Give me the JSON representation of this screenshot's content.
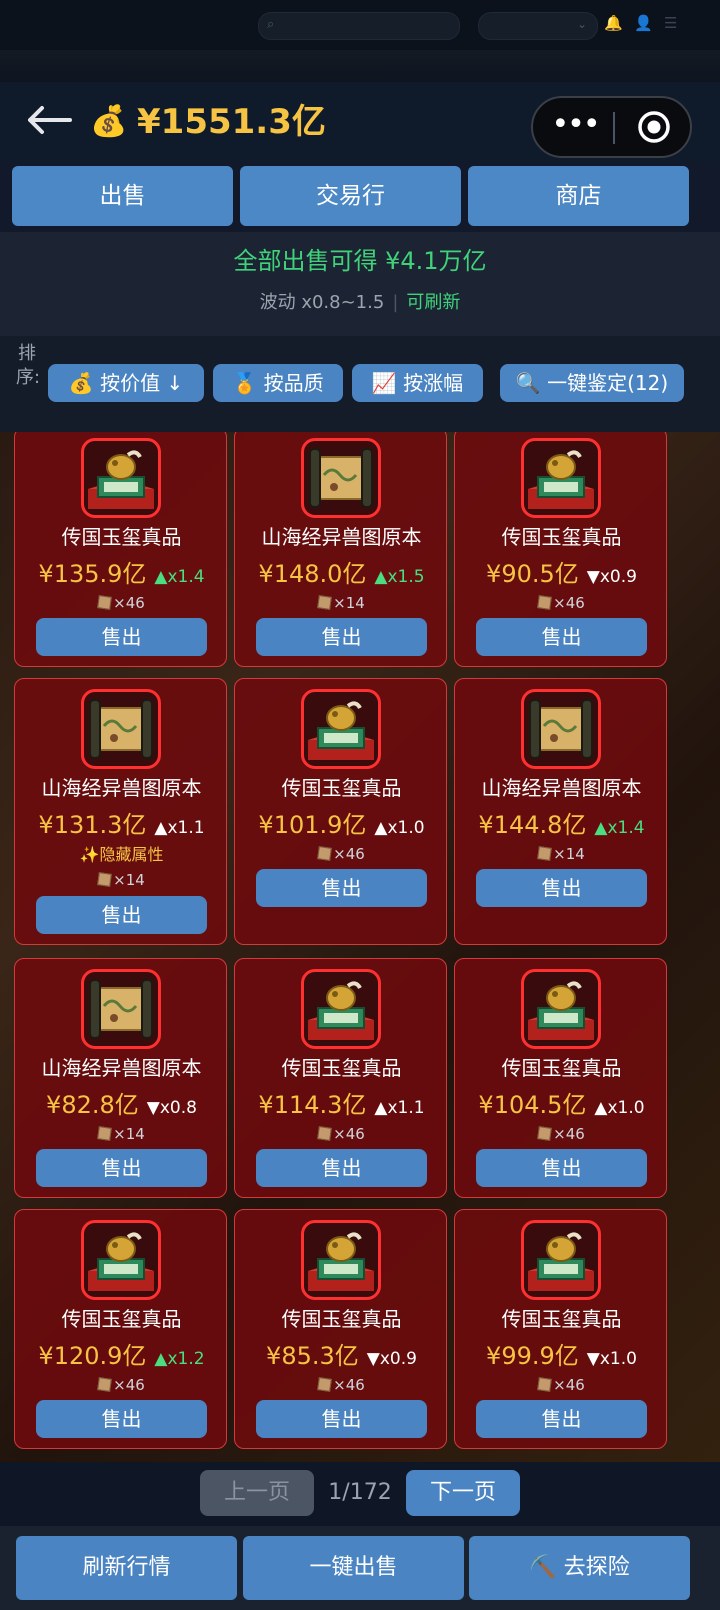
{
  "header": {
    "balance": "¥1551.3亿",
    "bag_icon": "💰"
  },
  "tabs": [
    {
      "label": "出售"
    },
    {
      "label": "交易行"
    },
    {
      "label": "商店"
    }
  ],
  "summary": {
    "total_prefix": "全部出售可得 ",
    "total_value": "¥4.1万亿",
    "fluctuation": "波动 x0.8~1.5",
    "refreshable": "可刷新"
  },
  "sort": {
    "label": "排序:",
    "buttons": [
      {
        "label": "💰 按价值 ↓"
      },
      {
        "label": "🏅 按品质"
      },
      {
        "label": "📈 按涨幅"
      },
      {
        "label": "🔍 一键鉴定(12)"
      }
    ]
  },
  "items": [
    {
      "name": "传国玉玺真品",
      "price": "¥135.9亿",
      "trend": "▲x1.4",
      "trend_color": "#4ade80",
      "qty": "×46",
      "icon": "jade-seal-icon",
      "sell": "售出"
    },
    {
      "name": "山海经异兽图原本",
      "price": "¥148.0亿",
      "trend": "▲x1.5",
      "trend_color": "#4ade80",
      "qty": "×14",
      "icon": "scroll-icon",
      "sell": "售出"
    },
    {
      "name": "传国玉玺真品",
      "price": "¥90.5亿",
      "trend": "▼x0.9",
      "trend_color": "#ffffff",
      "qty": "×46",
      "icon": "jade-seal-icon",
      "sell": "售出"
    },
    {
      "name": "山海经异兽图原本",
      "price": "¥131.3亿",
      "trend": "▲x1.1",
      "trend_color": "#ffffff",
      "hidden": "✨隐藏属性",
      "qty": "×14",
      "icon": "scroll-icon",
      "sell": "售出"
    },
    {
      "name": "传国玉玺真品",
      "price": "¥101.9亿",
      "trend": "▲x1.0",
      "trend_color": "#ffffff",
      "qty": "×46",
      "icon": "jade-seal-icon",
      "sell": "售出"
    },
    {
      "name": "山海经异兽图原本",
      "price": "¥144.8亿",
      "trend": "▲x1.4",
      "trend_color": "#4ade80",
      "qty": "×14",
      "icon": "scroll-icon",
      "sell": "售出"
    },
    {
      "name": "山海经异兽图原本",
      "price": "¥82.8亿",
      "trend": "▼x0.8",
      "trend_color": "#ffffff",
      "qty": "×14",
      "icon": "scroll-icon",
      "sell": "售出"
    },
    {
      "name": "传国玉玺真品",
      "price": "¥114.3亿",
      "trend": "▲x1.1",
      "trend_color": "#ffffff",
      "qty": "×46",
      "icon": "jade-seal-icon",
      "sell": "售出"
    },
    {
      "name": "传国玉玺真品",
      "price": "¥104.5亿",
      "trend": "▲x1.0",
      "trend_color": "#ffffff",
      "qty": "×46",
      "icon": "jade-seal-icon",
      "sell": "售出"
    },
    {
      "name": "传国玉玺真品",
      "price": "¥120.9亿",
      "trend": "▲x1.2",
      "trend_color": "#4ade80",
      "qty": "×46",
      "icon": "jade-seal-icon",
      "sell": "售出"
    },
    {
      "name": "传国玉玺真品",
      "price": "¥85.3亿",
      "trend": "▼x0.9",
      "trend_color": "#ffffff",
      "qty": "×46",
      "icon": "jade-seal-icon",
      "sell": "售出"
    },
    {
      "name": "传国玉玺真品",
      "price": "¥99.9亿",
      "trend": "▼x1.0",
      "trend_color": "#ffffff",
      "qty": "×46",
      "icon": "jade-seal-icon",
      "sell": "售出"
    }
  ],
  "pager": {
    "prev": "上一页",
    "page": "1/172",
    "next": "下一页"
  },
  "bottom": [
    {
      "label": "刷新行情"
    },
    {
      "label": "一键出售"
    },
    {
      "label": "⛏️ 去探险"
    }
  ],
  "colors": {
    "accent": "#4a84c2",
    "gold": "#f6c343",
    "green": "#3fd27a",
    "card_border": "#d43a3a"
  }
}
